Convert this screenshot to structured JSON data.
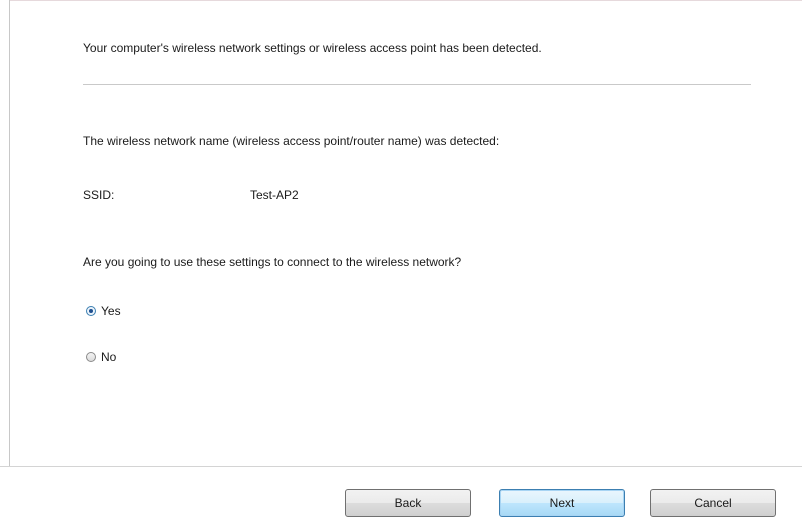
{
  "dialog": {
    "intro_text": "Your computer's wireless network settings or wireless access point has been detected.",
    "detected_text": "The wireless network name (wireless access point/router name) was detected:",
    "ssid_label": "SSID:",
    "ssid_value": "Test-AP2",
    "question_text": "Are you going to use these settings to connect to the wireless network?",
    "options": [
      {
        "label": "Yes",
        "selected": true
      },
      {
        "label": "No",
        "selected": false
      }
    ]
  },
  "buttons": {
    "back_label": "Back",
    "next_label": "Next",
    "cancel_label": "Cancel"
  }
}
